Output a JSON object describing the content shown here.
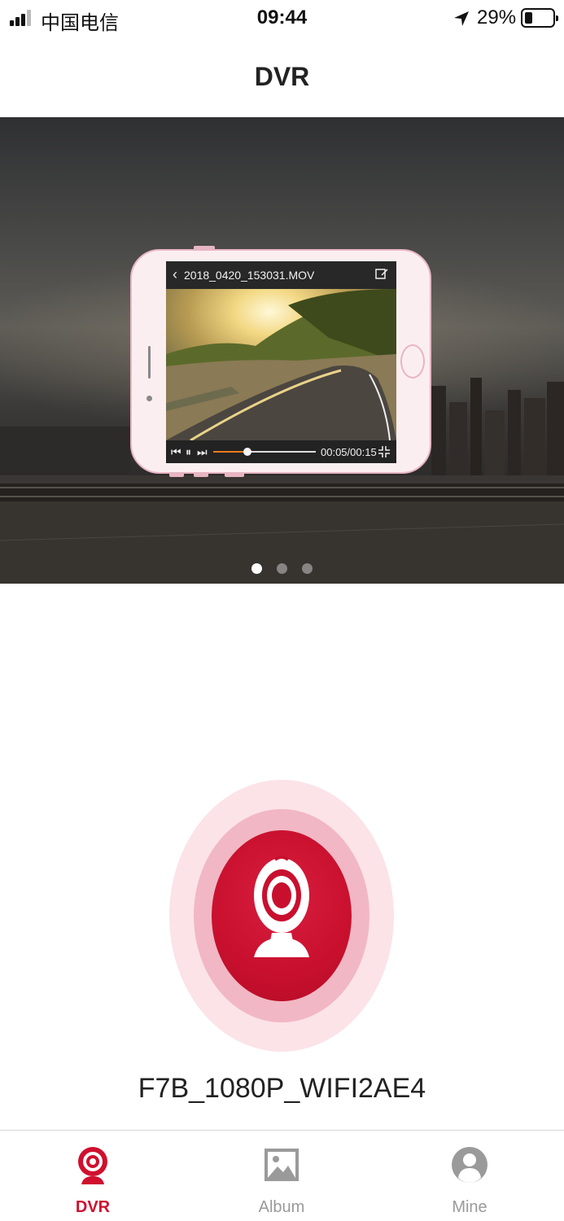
{
  "status_bar": {
    "carrier": "中国电信",
    "time": "09:44",
    "battery_percent_text": "29%",
    "battery_level": 0.29,
    "icons": [
      "signal-icon",
      "location-arrow-icon",
      "battery-icon"
    ]
  },
  "nav": {
    "title": "DVR"
  },
  "banner": {
    "preview_file_name": "2018_0420_153031.MOV",
    "preview_time": "00:05/00:15",
    "preview_progress": 0.33,
    "pages": 3,
    "active_page": 1
  },
  "device": {
    "name": "F7B_1080P_WIFI2AE4",
    "icon": "webcam-icon"
  },
  "tabs": [
    {
      "label": "DVR",
      "icon": "webcam-icon",
      "active": true
    },
    {
      "label": "Album",
      "icon": "image-icon",
      "active": false
    },
    {
      "label": "Mine",
      "icon": "user-icon",
      "active": false
    }
  ],
  "colors": {
    "accent": "#c8102e",
    "ring_outer": "#fbe3e8",
    "ring_middle": "#f2b7c4",
    "tab_inactive": "#9a9a9a"
  }
}
